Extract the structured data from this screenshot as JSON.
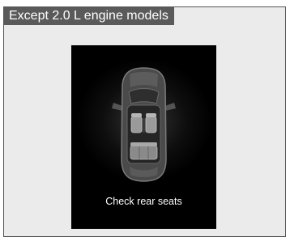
{
  "header": {
    "title": "Except 2.0 L engine models"
  },
  "display": {
    "message": "Check rear seats",
    "icon": "car-top-view-seats-icon"
  },
  "colors": {
    "frame_background": "#ebebeb",
    "header_background": "#5a5a5a",
    "screen_background": "#000000",
    "message_text": "#ffffff"
  }
}
